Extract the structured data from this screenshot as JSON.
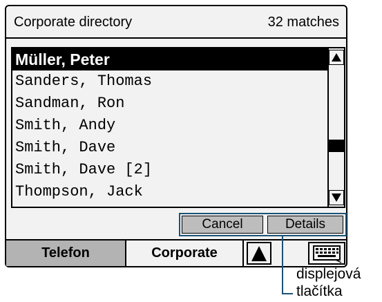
{
  "header": {
    "title": "Corporate directory",
    "matches": "32 matches"
  },
  "list": {
    "items": [
      {
        "label": "Müller, Peter",
        "selected": true
      },
      {
        "label": "Sanders, Thomas",
        "selected": false
      },
      {
        "label": "Sandman, Ron",
        "selected": false
      },
      {
        "label": "Smith, Andy",
        "selected": false
      },
      {
        "label": "Smith, Dave",
        "selected": false
      },
      {
        "label": "Smith, Dave [2]",
        "selected": false
      },
      {
        "label": "Thompson, Jack",
        "selected": false
      }
    ]
  },
  "softkeys": {
    "cancel": "Cancel",
    "details": "Details"
  },
  "tabs": {
    "telefon": "Telefon",
    "corporate": "Corporate"
  },
  "icons": {
    "scroll_up": "triangle-up-icon",
    "scroll_down": "triangle-down-icon",
    "tab_arrow": "triangle-up-icon",
    "keyboard": "keyboard-icon"
  },
  "callout": {
    "line1": "displejová",
    "line2": "tlačítka"
  },
  "colors": {
    "screen_bg": "#f2f2f2",
    "selection": "#000000",
    "softkey_bg": "#bdbdbd",
    "active_tab": "#b3b3b3",
    "callout_line": "#1a5276"
  }
}
